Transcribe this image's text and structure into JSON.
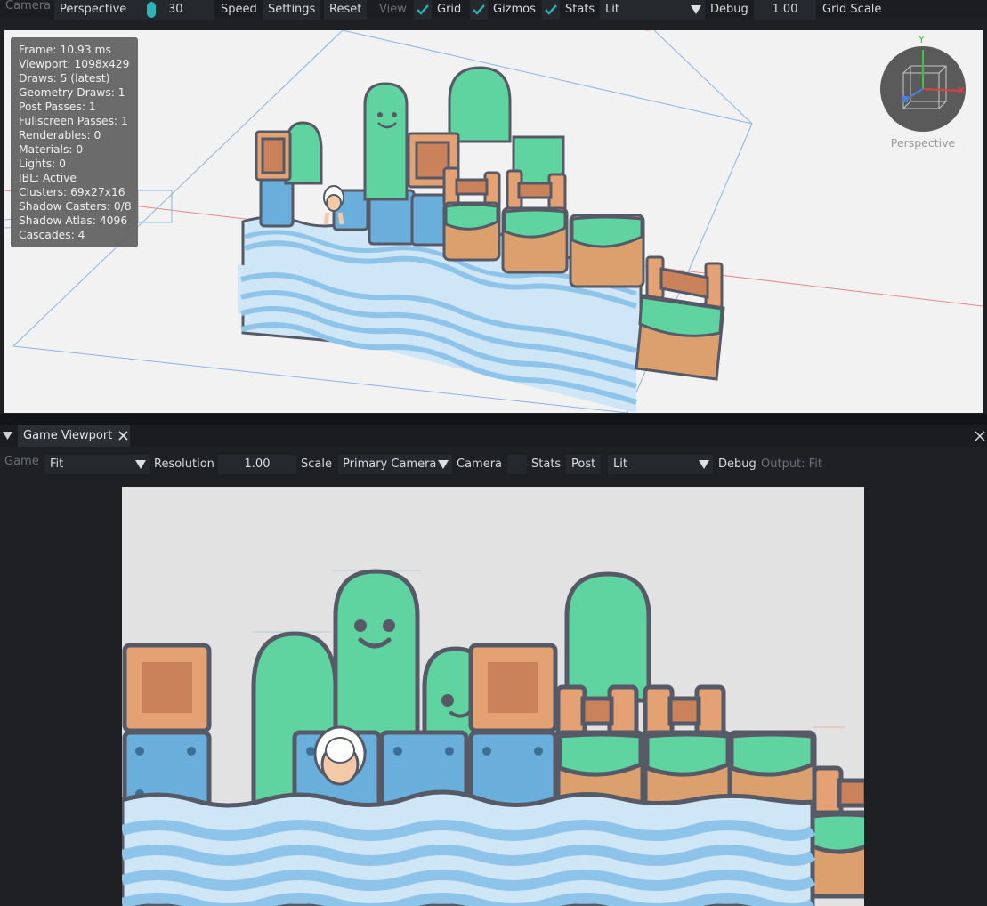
{
  "toolbar": {
    "camera_label": "Camera",
    "projection": "Perspective",
    "speed_value": "30",
    "speed_label": "Speed",
    "settings": "Settings",
    "reset": "Reset",
    "view_label": "View",
    "grid": "Grid",
    "gizmos": "Gizmos",
    "stats": "Stats",
    "shading": "Lit",
    "debug": "Debug",
    "grid_scale_value": "1.00",
    "grid_scale_label": "Grid Scale"
  },
  "stats_overlay": {
    "lines": [
      "Frame: 10.93 ms",
      "Viewport: 1098x429",
      "Draws: 5 (latest)",
      "Geometry Draws: 1",
      "Post Passes: 1",
      "Fullscreen Passes: 1",
      "Renderables: 0",
      "Materials: 0",
      "Lights: 0",
      "IBL: Active",
      "Clusters: 69x27x16",
      "Shadow Casters: 0/8",
      "Shadow Atlas: 4096",
      "Cascades: 4"
    ]
  },
  "gizmo": {
    "axis_y": "Y",
    "label": "Perspective"
  },
  "game_panel": {
    "tab_title": "Game Viewport",
    "game_label": "Game",
    "fit_mode": "Fit",
    "resolution_label": "Resolution",
    "scale_value": "1.00",
    "scale_label": "Scale",
    "camera_select": "Primary Camera",
    "camera_label": "Camera",
    "stats": "Stats",
    "post": "Post",
    "shading": "Lit",
    "debug": "Debug",
    "output": "Output: Fit"
  },
  "colors": {
    "accent": "#2fb3b8",
    "green": "#5fd3a0",
    "blue": "#6aaedb",
    "orange": "#e3a174",
    "outline": "#555a66"
  }
}
